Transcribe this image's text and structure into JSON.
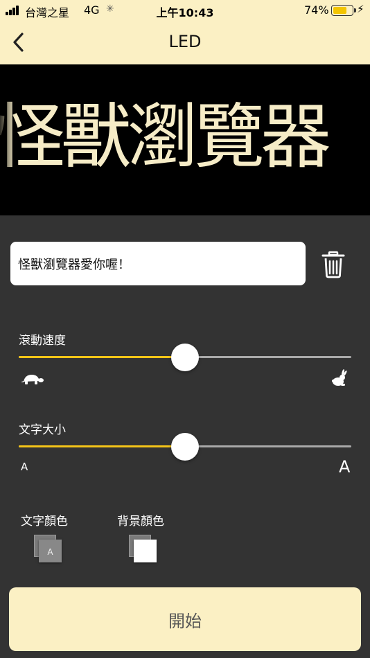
{
  "status_bar": {
    "carrier": "台灣之星",
    "network": "4G",
    "time": "上午10:43",
    "battery_percent": "74%",
    "battery_level": 0.74
  },
  "nav": {
    "title": "LED",
    "back_icon": "chevron-left-icon"
  },
  "preview": {
    "text": "怪獸瀏覽器",
    "text_color": "#f6ecc7",
    "background_color": "#000000"
  },
  "input": {
    "value": "怪獸瀏覽器愛你喔！",
    "clear_icon": "trash-icon"
  },
  "speed": {
    "label": "滾動速度",
    "value": 0.5,
    "slow_icon": "turtle-icon",
    "fast_icon": "rabbit-icon"
  },
  "size": {
    "label": "文字大小",
    "value": 0.5,
    "min_label": "A",
    "max_label": "A"
  },
  "colors": {
    "text_color_label": "文字顏色",
    "background_color_label": "背景顏色",
    "text_swatch_glyph": "A"
  },
  "start_button": "開始",
  "theme": {
    "accent": "#f5c518",
    "header_bg": "#fbf0c4",
    "panel_bg": "#333333"
  }
}
